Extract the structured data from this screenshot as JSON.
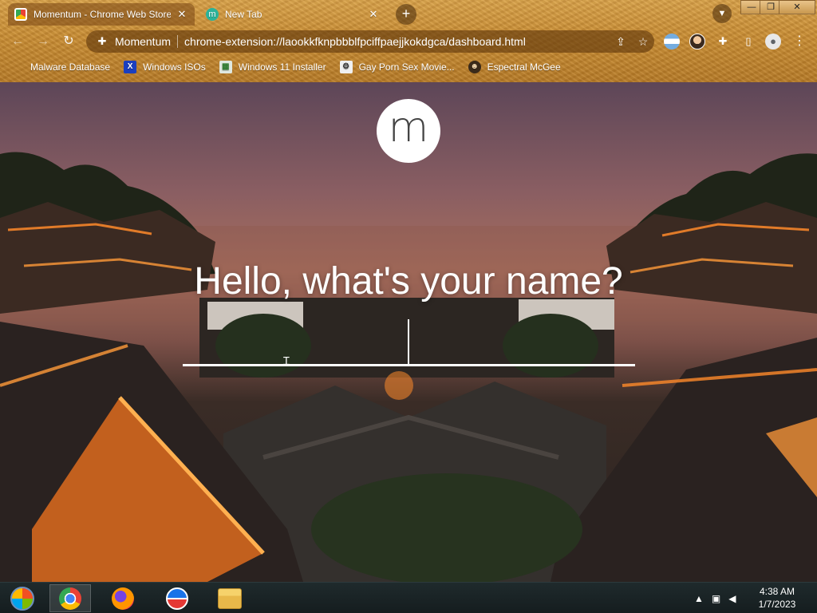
{
  "browser": {
    "tabs": [
      {
        "title": "Momentum - Chrome Web Store",
        "active": true,
        "favicon": "chrome-web-store-icon"
      },
      {
        "title": "New Tab",
        "active": false,
        "favicon": "momentum-m-icon"
      }
    ],
    "new_tab_label": "+",
    "window_controls": {
      "minimize": "—",
      "restore": "❐",
      "close": "✕"
    },
    "omnibox": {
      "site_chip": "Momentum",
      "url": "chrome-extension://laookkfknpbbblfpciffpaejjkokdgca/dashboard.html"
    },
    "bookmarks": [
      {
        "label": "Malware Database",
        "icon": "malware-database-icon"
      },
      {
        "label": "Windows ISOs",
        "icon": "windows-isos-icon"
      },
      {
        "label": "Windows 11 Installer",
        "icon": "windows-installer-icon"
      },
      {
        "label": "Gay Porn Sex Movie...",
        "icon": "bookmark-site-icon"
      },
      {
        "label": "Espectral McGee",
        "icon": "espectral-mcgee-icon"
      }
    ]
  },
  "momentum": {
    "logo_letter": "m",
    "greeting": "Hello, what's your name?",
    "name_value": ""
  },
  "taskbar": {
    "apps": [
      "windows-start-icon",
      "chrome-icon",
      "firefox-icon",
      "windows-live-icon",
      "file-explorer-icon"
    ],
    "clock": {
      "time": "4:38 AM",
      "date": "1/7/2023"
    }
  },
  "colors": {
    "chrome_accent": "#c98d34",
    "omnibox_bg": "#5f370c",
    "taskbar_bg": "#1a2325",
    "logo_bg": "#ffffff"
  }
}
